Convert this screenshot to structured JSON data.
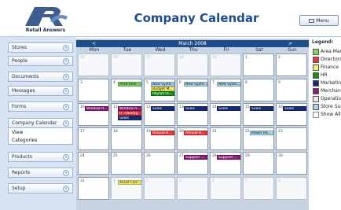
{
  "header": {
    "logo_text": "Retail Answers",
    "title": "Company Calendar",
    "menu_label": "Menu"
  },
  "sidebar": {
    "items": [
      {
        "label": "Stores"
      },
      {
        "label": "People"
      },
      {
        "label": "Documents"
      },
      {
        "label": "Messages"
      },
      {
        "label": "Forms"
      }
    ],
    "open_section": {
      "label": "Company Calendar",
      "sub_items": [
        "View",
        "Categories"
      ]
    },
    "items_after": [
      {
        "label": "Products"
      },
      {
        "label": "Reports"
      },
      {
        "label": "Setup"
      }
    ]
  },
  "calendar": {
    "prev_label": "<",
    "next_label": ">",
    "month_label": "March 2008",
    "weekdays": [
      "Mon",
      "Tue",
      "Wed",
      "Thu",
      "Fri",
      "Sat",
      "Sun"
    ],
    "weeks": [
      [
        "25",
        "26",
        "27",
        "28",
        "29",
        "1",
        "2"
      ],
      [
        "3",
        "4",
        "5",
        "6",
        "7",
        "8",
        "9"
      ],
      [
        "10",
        "11",
        "12",
        "13",
        "14",
        "15",
        "16"
      ],
      [
        "17",
        "18",
        "19",
        "20",
        "21",
        "22",
        "23"
      ],
      [
        "24",
        "25",
        "26",
        "27",
        "28",
        "29",
        "30"
      ],
      [
        "31",
        "1",
        "2",
        "3",
        "4",
        "5",
        "6"
      ]
    ],
    "other_month_days": [
      [
        0,
        0
      ],
      [
        0,
        1
      ],
      [
        0,
        2
      ],
      [
        0,
        3
      ],
      [
        0,
        4
      ],
      [
        5,
        1
      ],
      [
        5,
        2
      ],
      [
        5,
        3
      ],
      [
        5,
        4
      ],
      [
        5,
        5
      ],
      [
        5,
        6
      ]
    ],
    "events": [
      {
        "week": 1,
        "day": 1,
        "slot": 0,
        "label": "Area Revi...",
        "category": "Area Managers"
      },
      {
        "week": 1,
        "day": 2,
        "slot": 0,
        "label": "New Syste...",
        "category": "Store Support"
      },
      {
        "week": 1,
        "day": 2,
        "slot": 1,
        "label": "Budget M...",
        "category": "Finance"
      },
      {
        "week": 1,
        "day": 2,
        "slot": 2,
        "label": "Payroll re...",
        "category": "HR"
      },
      {
        "week": 1,
        "day": 3,
        "slot": 0,
        "label": "New Syste...",
        "category": "Store Support"
      },
      {
        "week": 1,
        "day": 4,
        "slot": 0,
        "label": "New Syste...",
        "category": "Store Support"
      },
      {
        "week": 2,
        "day": 0,
        "slot": 0,
        "label": "Window d...",
        "category": "Merchandising"
      },
      {
        "week": 2,
        "day": 1,
        "slot": 0,
        "label": "Window d...",
        "category": "Merchandising"
      },
      {
        "week": 2,
        "day": 1,
        "slot": 1,
        "label": "IT Training",
        "category": "Directors"
      },
      {
        "week": 2,
        "day": 1,
        "slot": 2,
        "label": "Sales",
        "category": "Marketing"
      },
      {
        "week": 2,
        "day": 2,
        "slot": 0,
        "label": "Sales",
        "category": "Marketing"
      },
      {
        "week": 2,
        "day": 3,
        "slot": 0,
        "label": "Sales",
        "category": "Marketing"
      },
      {
        "week": 2,
        "day": 4,
        "slot": 0,
        "label": "Sales",
        "category": "Marketing"
      },
      {
        "week": 2,
        "day": 5,
        "slot": 0,
        "label": "Sales",
        "category": "Marketing"
      },
      {
        "week": 2,
        "day": 6,
        "slot": 0,
        "label": "Sales",
        "category": "Marketing"
      },
      {
        "week": 3,
        "day": 2,
        "slot": 0,
        "label": "Annual R...",
        "category": "Directors"
      },
      {
        "week": 3,
        "day": 3,
        "slot": 0,
        "label": "Annual R...",
        "category": "Directors"
      },
      {
        "week": 3,
        "day": 5,
        "slot": 0,
        "label": "Power Re...",
        "category": "Store Support"
      },
      {
        "week": 4,
        "day": 3,
        "slot": 0,
        "label": "Supplier ...",
        "category": "Merchandising"
      },
      {
        "week": 4,
        "day": 4,
        "slot": 0,
        "label": "Supplier ...",
        "category": "Merchandising"
      },
      {
        "week": 5,
        "day": 1,
        "slot": 0,
        "label": "Asset Calc...",
        "category": "Finance"
      }
    ]
  },
  "legend": {
    "title": "Legend:",
    "items": [
      {
        "label": "Area Managers",
        "color": "#7ed05f"
      },
      {
        "label": "Directors",
        "color": "#e23a3a"
      },
      {
        "label": "Finance",
        "color": "#f5f06a"
      },
      {
        "label": "HR",
        "color": "#1a8a1a"
      },
      {
        "label": "Marketing",
        "color": "#1a2a7a"
      },
      {
        "label": "Merchandising",
        "color": "#8a1a7a"
      },
      {
        "label": "Operations",
        "color": "#e8e8e8"
      },
      {
        "label": "Store Support",
        "color": "#a8d4e8"
      }
    ],
    "show_all_label": "Show All"
  }
}
